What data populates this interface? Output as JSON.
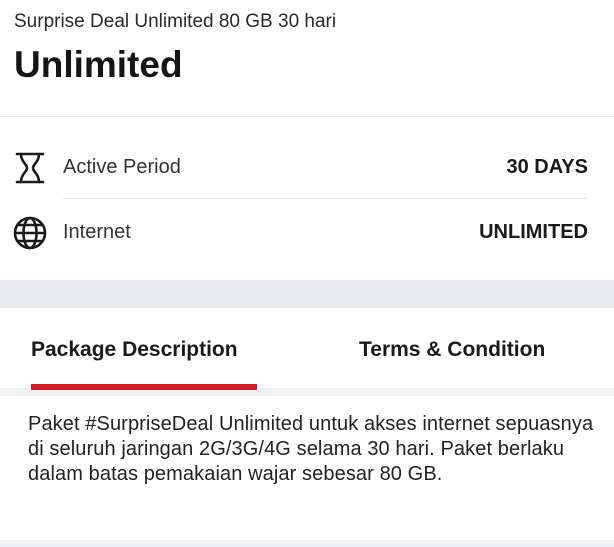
{
  "header": {
    "subtitle": "Surprise Deal Unlimited 80 GB 30 hari",
    "title": "Unlimited"
  },
  "details": [
    {
      "icon": "hourglass-icon",
      "label": "Active Period",
      "value": "30 DAYS"
    },
    {
      "icon": "globe-icon",
      "label": "Internet",
      "value": "UNLIMITED"
    }
  ],
  "tabs": [
    {
      "label": "Package Description",
      "active": true
    },
    {
      "label": "Terms & Condition",
      "active": false
    }
  ],
  "description": "Paket #SurpriseDeal Unlimited untuk akses internet sepuasnya di seluruh jaringan 2G/3G/4G selama 30 hari. Paket berlaku dalam batas pemakaian wajar sebesar 80 GB.",
  "colors": {
    "accent": "#d21f2a",
    "band": "#eaecef"
  }
}
